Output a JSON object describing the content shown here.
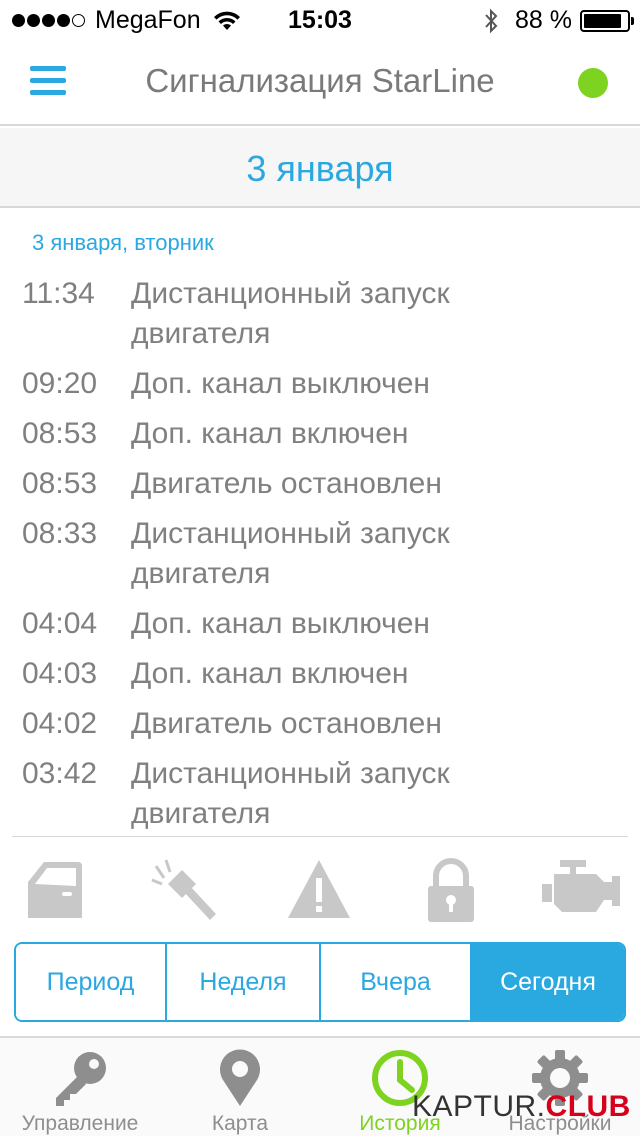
{
  "status_bar": {
    "carrier": "MegaFon",
    "time": "15:03",
    "battery_text": "88 %",
    "battery_level": 0.88,
    "signal_bars": 4,
    "signal_max": 5
  },
  "navbar": {
    "title": "Сигнализация StarLine",
    "menu_icon": "menu-icon",
    "status_color": "#7ed321"
  },
  "date_header": "3 января",
  "day_label": "3 января, вторник",
  "events": [
    {
      "time": "11:34",
      "text": "Дистанционный запуск двигателя"
    },
    {
      "time": "09:20",
      "text": "Доп. канал выключен"
    },
    {
      "time": "08:53",
      "text": "Доп. канал включен"
    },
    {
      "time": "08:53",
      "text": "Двигатель остановлен"
    },
    {
      "time": "08:33",
      "text": "Дистанционный запуск двигателя"
    },
    {
      "time": "04:04",
      "text": "Доп. канал выключен"
    },
    {
      "time": "04:03",
      "text": "Доп. канал включен"
    },
    {
      "time": "04:02",
      "text": "Двигатель остановлен"
    },
    {
      "time": "03:42",
      "text": "Дистанционный запуск двигателя"
    }
  ],
  "filter_icons": [
    "car-door-icon",
    "hammer-impact-icon",
    "warning-icon",
    "lock-icon",
    "engine-icon"
  ],
  "segments": [
    {
      "label": "Период",
      "active": false
    },
    {
      "label": "Неделя",
      "active": false
    },
    {
      "label": "Вчера",
      "active": false
    },
    {
      "label": "Сегодня",
      "active": true
    }
  ],
  "tabs": [
    {
      "label": "Управление",
      "icon": "key-icon",
      "active": false
    },
    {
      "label": "Карта",
      "icon": "map-pin-icon",
      "active": false
    },
    {
      "label": "История",
      "icon": "clock-icon",
      "active": true
    },
    {
      "label": "Настройки",
      "icon": "gear-icon",
      "active": false
    }
  ],
  "watermark": {
    "part1": "KAPTUR.",
    "part2": "CLUB"
  },
  "colors": {
    "accent": "#2aa8e0",
    "active_tab": "#7ed321",
    "text_gray": "#808080",
    "icon_gray": "#c8c8c8"
  }
}
